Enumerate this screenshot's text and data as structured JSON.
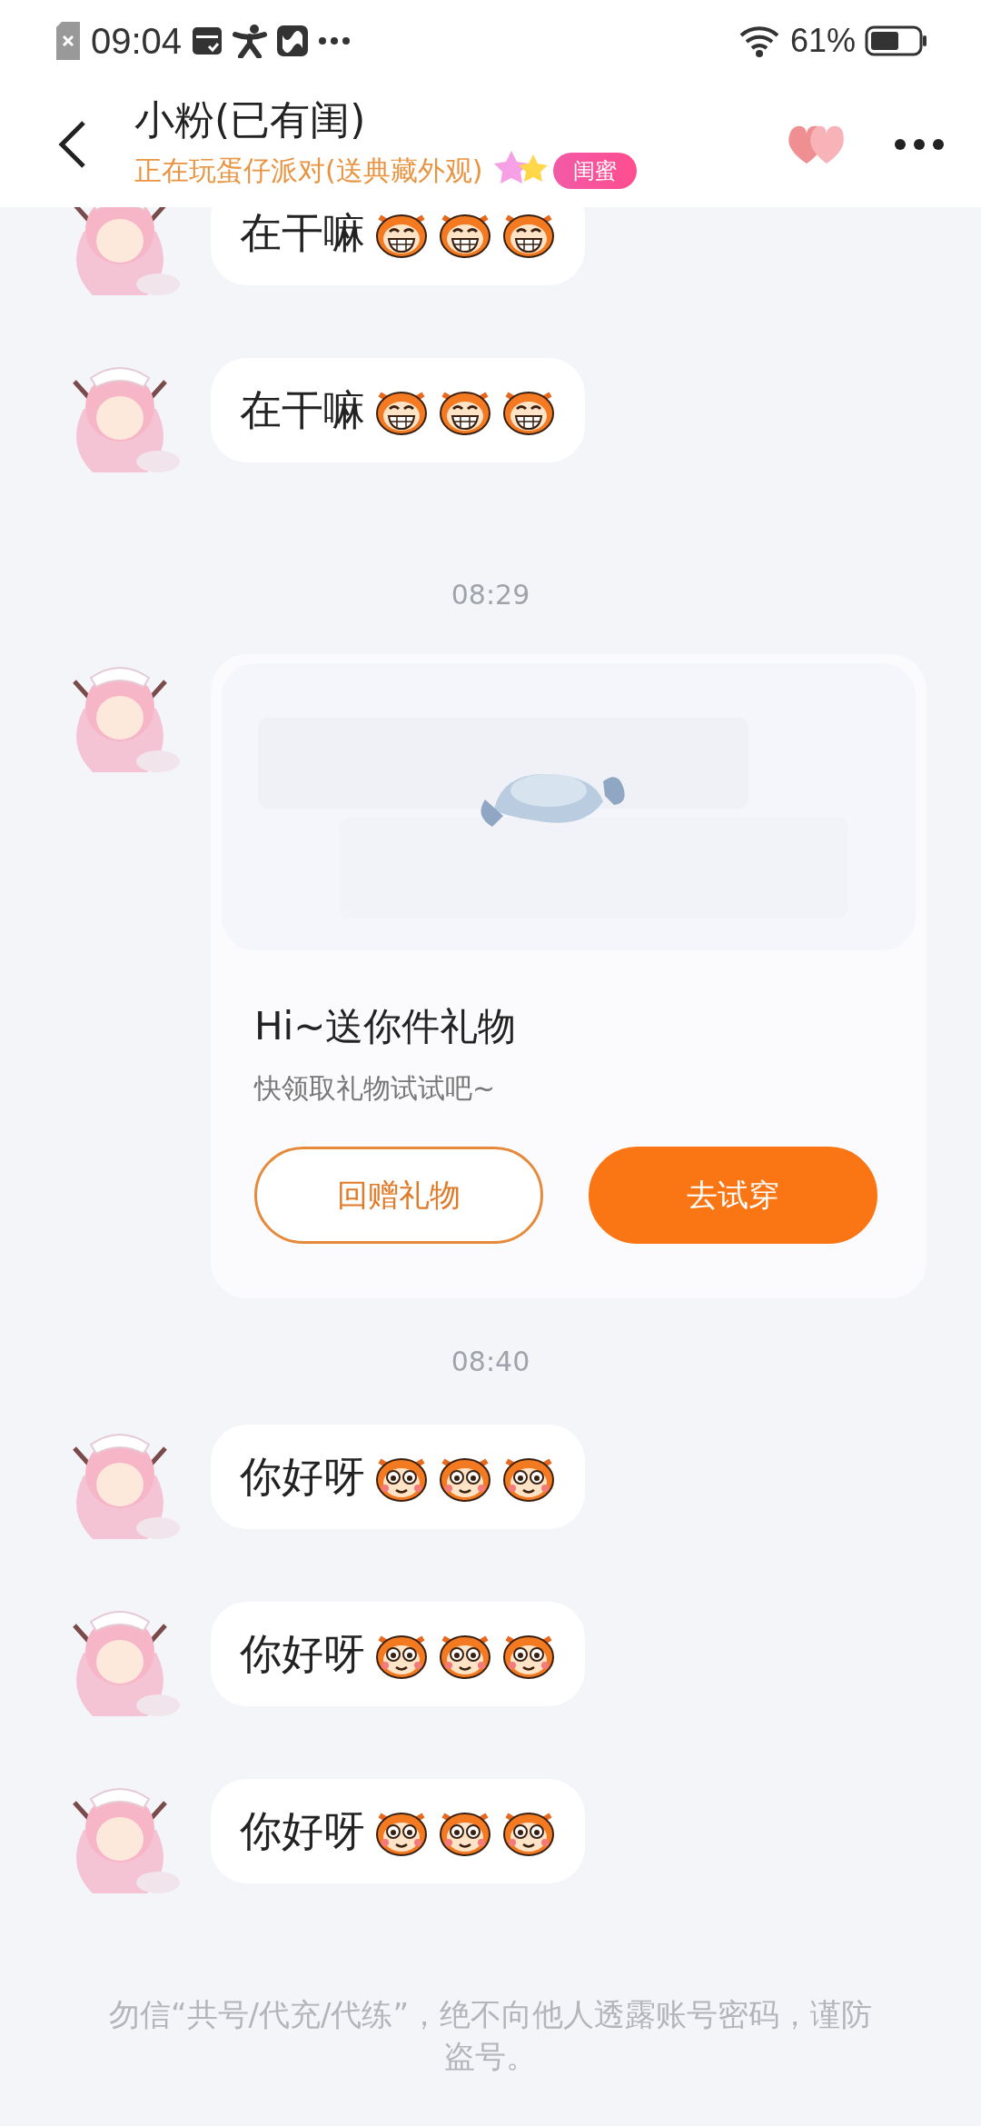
{
  "status_bar": {
    "time": "09:04",
    "battery": "61%"
  },
  "header": {
    "title": "小粉(已有闺)",
    "subtitle": "正在玩蛋仔派对(送典藏外观)",
    "badge": "闺蜜"
  },
  "timeline": [
    {
      "kind": "text",
      "text": "在干嘛",
      "emojis": [
        {
          "kind": "grin"
        },
        {
          "kind": "grin"
        },
        {
          "kind": "grin"
        }
      ]
    },
    {
      "kind": "text",
      "text": "在干嘛",
      "emojis": [
        {
          "kind": "grin"
        },
        {
          "kind": "grin"
        },
        {
          "kind": "grin"
        }
      ]
    },
    {
      "kind": "time",
      "text": "08:29"
    },
    {
      "kind": "gift",
      "title": "Hi~送你件礼物",
      "subtitle": "快领取礼物试试吧~",
      "buttons": [
        {
          "label": "回赠礼物",
          "kind": "outline"
        },
        {
          "label": "去试穿",
          "kind": "filled"
        }
      ]
    },
    {
      "kind": "time",
      "text": "08:40"
    },
    {
      "kind": "text",
      "text": "你好呀",
      "emojis": [
        {
          "kind": "smile"
        },
        {
          "kind": "smile"
        },
        {
          "kind": "smile"
        }
      ]
    },
    {
      "kind": "text",
      "text": "你好呀",
      "emojis": [
        {
          "kind": "smile"
        },
        {
          "kind": "smile"
        },
        {
          "kind": "smile"
        }
      ]
    },
    {
      "kind": "text",
      "text": "你好呀",
      "emojis": [
        {
          "kind": "smile"
        },
        {
          "kind": "smile"
        },
        {
          "kind": "smile"
        }
      ]
    }
  ],
  "notice": "勿信“共号/代充/代练”，绝不向他人透露账号密码，谨防盗号。"
}
